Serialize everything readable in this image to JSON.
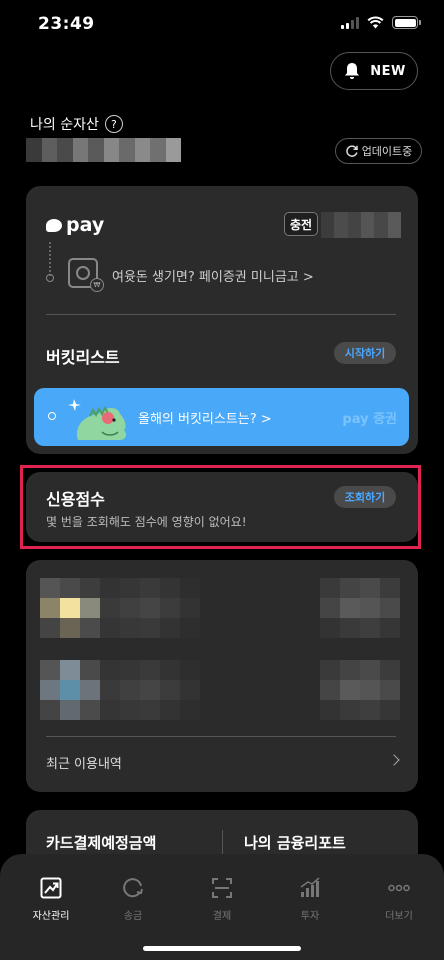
{
  "status": {
    "time": "23:49"
  },
  "header": {
    "notification_label": "NEW"
  },
  "assets": {
    "net_asset_label": "나의 순자산",
    "help_glyph": "?",
    "update_label": "업데이트중"
  },
  "pay_card": {
    "pay_logo_text": "pay",
    "charge_label": "충전",
    "spare_money_text": "여윳돈 생기면? 페이증권 미니금고 >",
    "bucket_title": "버킷리스트",
    "bucket_start_label": "시작하기",
    "banner_text": "올해의 버킷리스트는? >",
    "banner_logo": "pay 증권"
  },
  "credit": {
    "title": "신용점수",
    "subtitle": "몇 번을 조회해도 점수에 영향이 없어요!",
    "inquiry_label": "조회하기"
  },
  "accounts": {
    "recent_label": "최근 이용내역"
  },
  "reports": {
    "card_payment_label": "카드결제예정금액",
    "finance_report_label": "나의 금융리포트"
  },
  "tabs": [
    {
      "label": "자산관리",
      "icon": "chart-up-icon",
      "active": true
    },
    {
      "label": "송금",
      "icon": "send-circle-icon",
      "active": false
    },
    {
      "label": "결제",
      "icon": "scan-icon",
      "active": false
    },
    {
      "label": "투자",
      "icon": "bars-icon",
      "active": false
    },
    {
      "label": "더보기",
      "icon": "more-dots-icon",
      "active": false
    }
  ],
  "colors": {
    "background": "#000000",
    "card": "#2b2b2b",
    "accent_blue": "#49a8f7",
    "highlight_red": "#e02451",
    "tabbar": "#262626"
  }
}
